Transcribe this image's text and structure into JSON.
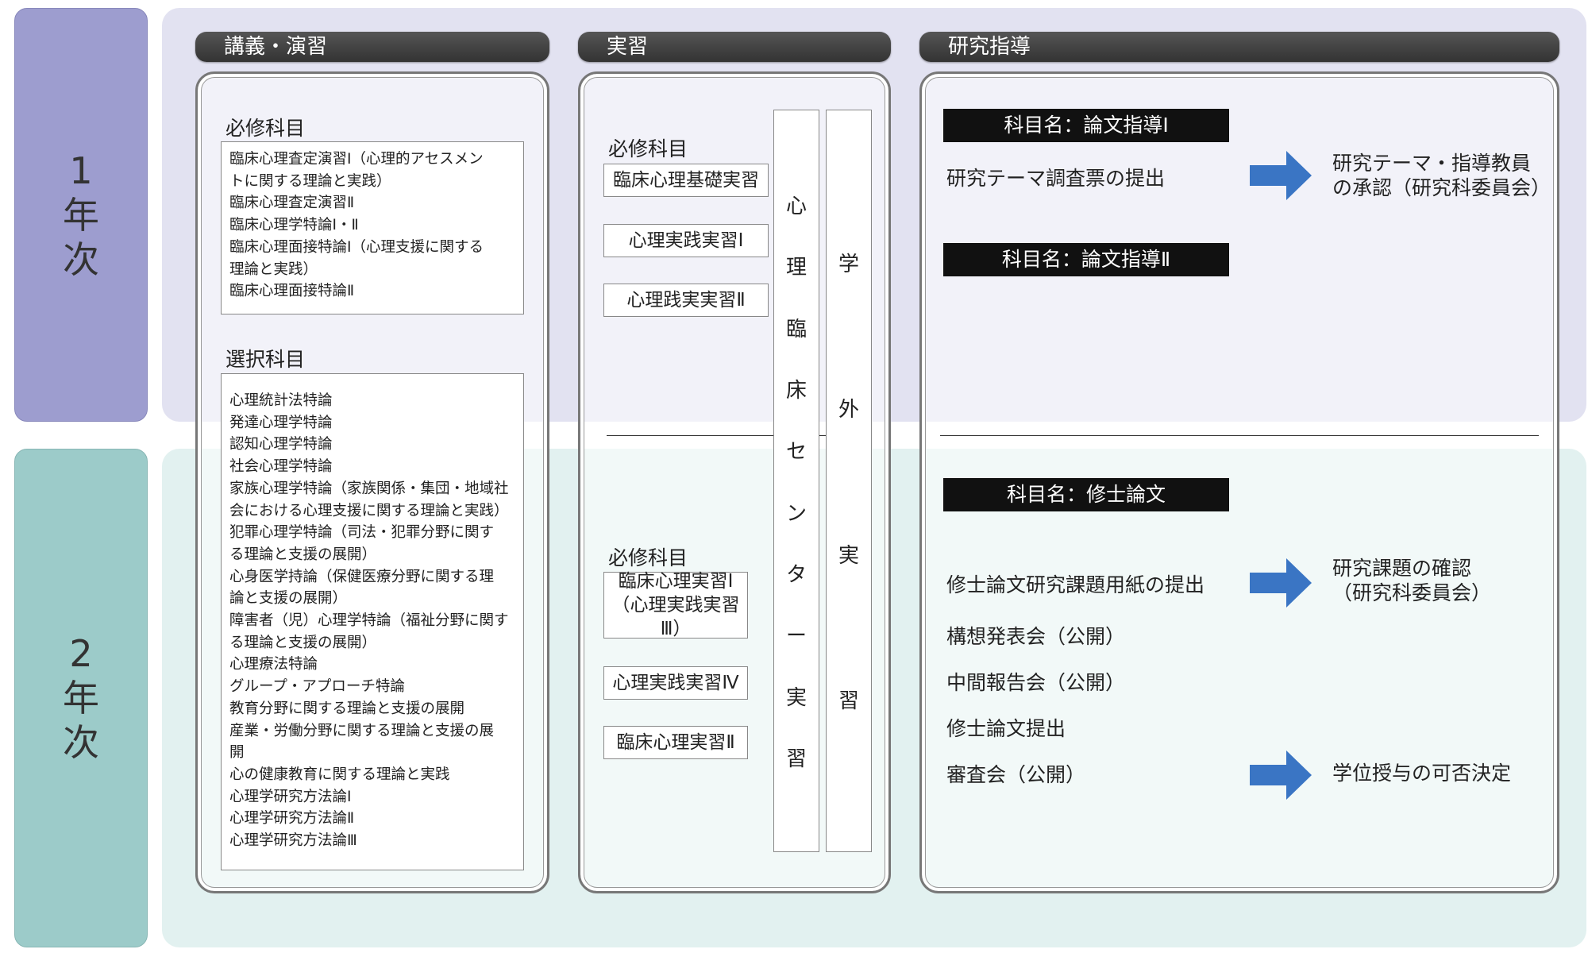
{
  "years": [
    {
      "label_num": "1",
      "label_a": "年",
      "label_b": "次"
    },
    {
      "label_num": "2",
      "label_a": "年",
      "label_b": "次"
    }
  ],
  "columns": {
    "lectures": "講義・演習",
    "practicum": "実習",
    "research": "研究指導"
  },
  "lectures": {
    "required_label": "必修科目",
    "required_items": [
      "臨床心理査定演習Ⅰ（心理的アセスメン",
      "トに関する理論と実践）",
      "臨床心理査定演習Ⅱ",
      "臨床心理学特論Ⅰ・Ⅱ",
      "臨床心理面接特論Ⅰ（心理支援に関する",
      "理論と実践）",
      "臨床心理面接特論Ⅱ"
    ],
    "elective_label": "選択科目",
    "elective_items": [
      "心理統計法特論",
      "発達心理学特論",
      "認知心理学特論",
      "社会心理学特論",
      "家族心理学特論（家族関係・集団・地域社",
      "会における心理支援に関する理論と実践）",
      "犯罪心理学特論（司法・犯罪分野に関す",
      "る理論と支援の展開）",
      "心身医学持論（保健医療分野に関する理",
      "論と支援の展開）",
      "障害者（児）心理学特論（福祉分野に関す",
      "る理論と支援の展開）",
      "心理療法特論",
      "グループ・アプローチ特論",
      "教育分野に関する理論と支援の展開",
      "産業・労働分野に関する理論と支援の展",
      "開",
      "心の健康教育に関する理論と実践",
      "心理学研究方法論Ⅰ",
      "心理学研究方法論Ⅱ",
      "心理学研究方法論Ⅲ"
    ]
  },
  "practicum": {
    "y1_required_label": "必修科目",
    "y1_items": [
      "臨床心理基礎実習",
      "心理実践実習Ⅰ",
      "心理践実実習Ⅱ"
    ],
    "y2_required_label": "必修科目",
    "y2_item1_line1": "臨床心理実習Ⅰ",
    "y2_item1_line2": "（心理実践実習Ⅲ）",
    "y2_item2": "心理実践実習Ⅳ",
    "y2_item3": "臨床心理実習Ⅱ",
    "center_vertical": [
      "心",
      "理",
      "臨",
      "床",
      "セ",
      "ン",
      "タ",
      "ー",
      "実",
      "習"
    ],
    "external_vertical": [
      "学",
      "外",
      "実",
      "習"
    ]
  },
  "research": {
    "thesis1": "科目名：論文指導Ⅰ",
    "step_theme": "研究テーマ調査票の提出",
    "result_theme_1": "研究テーマ・指導教員",
    "result_theme_2": "の承認（研究科委員会）",
    "thesis2": "科目名：論文指導Ⅱ",
    "thesis_master": "科目名：修士論文",
    "step_topic": "修士論文研究課題用紙の提出",
    "result_topic_1": "研究課題の確認",
    "result_topic_2": "（研究科委員会）",
    "step_plan": "構想発表会（公開）",
    "step_interim": "中間報告会（公開）",
    "step_submit": "修士論文提出",
    "step_review": "審査会（公開）",
    "result_degree": "学位授与の可否決定"
  },
  "colors": {
    "year1_tab": "#9d9dcf",
    "year1_band": "#e2e2f1",
    "year2_tab": "#9ccbc9",
    "year2_band": "#e2f1f0",
    "header_bar": "#444444",
    "arrow": "#3a75c4"
  },
  "icons": {
    "flow_arrow": "right-arrow-icon"
  }
}
